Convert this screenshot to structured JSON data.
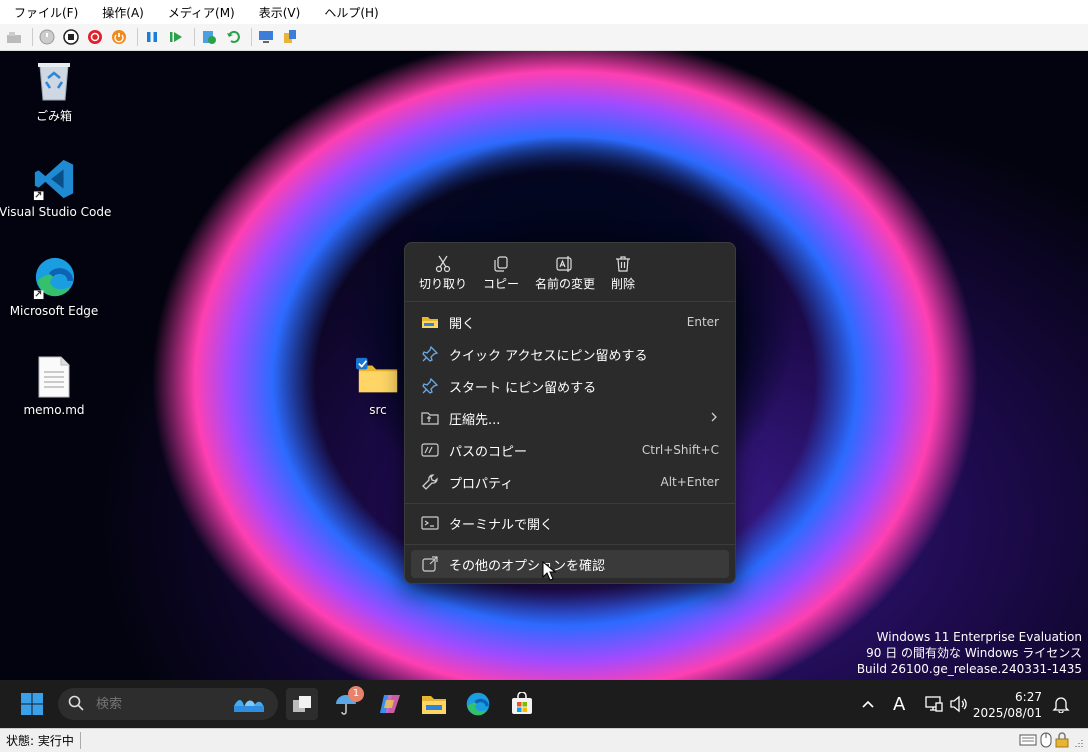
{
  "menubar": {
    "items": [
      "ファイル(F)",
      "操作(A)",
      "メディア(M)",
      "表示(V)",
      "ヘルプ(H)"
    ]
  },
  "desktop": {
    "icons": [
      {
        "label": "ごみ箱",
        "icon": "recycle-bin-icon"
      },
      {
        "label": "Visual Studio Code",
        "icon": "vscode-icon"
      },
      {
        "label": "Microsoft Edge",
        "icon": "edge-icon"
      },
      {
        "label": "memo.md",
        "icon": "document-icon"
      },
      {
        "label": "src",
        "icon": "folder-icon"
      }
    ],
    "watermark": [
      "Windows 11 Enterprise Evaluation",
      "90 日 の間有効な Windows ライセンス",
      "Build 26100.ge_release.240331-1435"
    ]
  },
  "context_menu": {
    "top_actions": [
      {
        "label": "切り取り",
        "icon": "scissors-icon"
      },
      {
        "label": "コピー",
        "icon": "copy-icon"
      },
      {
        "label": "名前の変更",
        "icon": "rename-icon"
      },
      {
        "label": "削除",
        "icon": "trash-icon"
      }
    ],
    "items": [
      {
        "label": "開く",
        "shortcut": "Enter",
        "icon": "folder-open-icon"
      },
      {
        "label": "クイック アクセスにピン留めする",
        "shortcut": "",
        "icon": "pin-icon"
      },
      {
        "label": "スタート にピン留めする",
        "shortcut": "",
        "icon": "pin-icon"
      },
      {
        "label": "圧縮先...",
        "shortcut": "",
        "icon": "archive-icon"
      },
      {
        "label": "パスのコピー",
        "shortcut": "Ctrl+Shift+C",
        "icon": "copy-path-icon"
      },
      {
        "label": "プロパティ",
        "shortcut": "Alt+Enter",
        "icon": "wrench-icon"
      },
      {
        "label": "ターミナルで開く",
        "shortcut": "",
        "icon": "terminal-icon"
      },
      {
        "label": "その他のオプションを確認",
        "shortcut": "",
        "icon": "more-options-icon"
      }
    ]
  },
  "taskbar": {
    "search_placeholder": "検索",
    "weather_badge": "1",
    "ime": "A",
    "time": "6:27",
    "date": "2025/08/01"
  },
  "statusbar": {
    "status": "状態: 実行中"
  },
  "colors": {
    "accent": "#0078d4",
    "menu_bg": "#2b2b2b",
    "taskbar_bg": "#1c1c1c"
  }
}
